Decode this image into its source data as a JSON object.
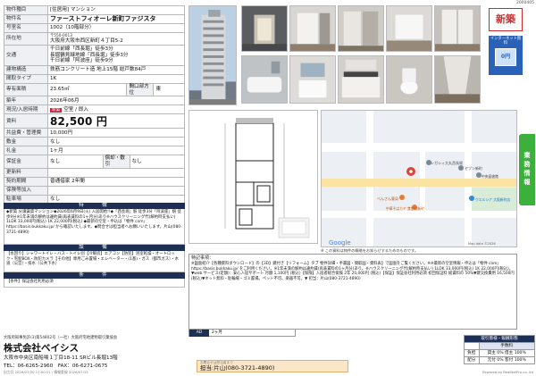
{
  "sheet_number": "2000405",
  "property": {
    "rows_top": [
      {
        "key": "物件種目",
        "value": "[住居用] マンション"
      },
      {
        "key": "物件名",
        "value": "ファーストフィオーレ新町ファジスタ"
      },
      {
        "key": "号室名",
        "value": "1002（10階部分）"
      }
    ],
    "location": {
      "key": "所在地",
      "zip": "〒550-0013",
      "address": "大阪府大阪市西区新町４丁目5-2"
    },
    "transport": {
      "key": "交通",
      "lines": [
        "千日前線「西長堀」徒歩3分",
        "長堀鶴見緑地線「西長堀」徒歩3分",
        "千日前線「阿波座」徒歩9分"
      ]
    },
    "structure": {
      "key": "建物構造",
      "value": "鉄筋コンクリート造 地上15階 総戸数84戸"
    },
    "layout": {
      "key": "間取タイプ",
      "value": "1K"
    },
    "area": {
      "key": "専有面積",
      "value": "23.65㎡",
      "key2": "間口部方位",
      "value2": "東"
    },
    "built": {
      "key": "築年",
      "value": "2026年06月"
    },
    "move_in": {
      "key": "現況/入居時期",
      "tag": "新築",
      "value": "空室 / 即入"
    },
    "rent": {
      "key": "賃料",
      "value": "82,500 円"
    },
    "common_fee": {
      "key": "共益費・管理費",
      "value": "10,000円"
    },
    "deposit": {
      "key": "敷金",
      "value": "なし"
    },
    "key_money": {
      "key": "礼金",
      "value": "1ヶ月"
    },
    "guarantee": {
      "key": "保証金",
      "value": "なし",
      "key2": "償却・敷引",
      "value2": "なし"
    },
    "renewal": {
      "key": "更新料",
      "value": ""
    },
    "contract_period": {
      "key": "契約期間",
      "value": "普通借家 2年間"
    },
    "insurance": {
      "key": "保険等加入",
      "value": ""
    },
    "parking": {
      "key": "駐車場",
      "value": "なし"
    }
  },
  "features": {
    "heading": "特　　徴",
    "text": "◆新築 分譲賃貸マンション◆2026年6月9日(火) 入居開始!!◆「西長堀」駅 徒歩3分「阿波座」駅 徒歩9分※1年未満の解約は違約賃(再表賃料の1ヶ月分)あり※ハウスクリーニング代(解約時支払い) 1LDK 33,000円(税込) 1K 22,000円(税込) ◆最新の空室・申込は「物件 com」https://basis.bukkaku.jp/ から確認いたします。◆問合せは担当者へお願いいたします。片山(080-3721-4890)"
  },
  "equipment": {
    "heading": "設　　備",
    "text": "【水回り】シャワートイレ・バス・トイレ別【冷暖房】エアコン【防犯】浴室乾燥・オートロック・宅配BOX・防犯カメラ【その他】専用ごみ置場・エレベーター・(1基)・ガス（都市ガス）・水道（公営）・排水（公共下水）"
  },
  "conditions": {
    "heading": "条　　件",
    "text": "【条件】保証会社利用必須"
  },
  "badges": {
    "new_label": "新築",
    "net_label": "インターネット無料",
    "net_screen": "0円"
  },
  "side_tab": "業務情報",
  "map": {
    "labels": [
      "レガシィ大丸西長堀",
      "セブン新町",
      "中央図書館",
      "べんさん薬局",
      "中華そばカヤ 食堂処新町",
      "ウエルシア 大阪新町店"
    ],
    "logo": "Google",
    "copyright": "Map data ©2026",
    "note": "※ この資料は物件の概略をお知らせするためのものです。"
  },
  "notes": {
    "title": "特記事項：",
    "text": "※図面紹介【各種資料ダウンロード】の【3D】鍵付き【リフォーム】タブ 物件詳細・手書図・間取図・資料表】で図面をご覧ください。※※最新の空室情報・申込は「物件 com」https://basis.bukkaku.jp/ をご利用ください。※1年未満の解約は違約賃(再表賃料の1ヶ月分)あり。※ハウスクリーニング代(解約時支払い) 1LDK 33,000円(税込) 1K 22,000円(税込)。▼web サービス(定額)：安心入居サポート 月額 1,100円 (税込)【保険】入居者総合保険 2年 20,000円 (税込)【保証】保証会社利用必須 初回保証料 総賃料の 50%▼鍵交換費用 16,500円 (税込)▼ネット無料・駐輪場・ゴミ置場。ペット不可、楽器不可。▼ 担当：片山(080-3721-4890)"
  },
  "strip": {
    "cells": [
      "AD",
      "2ヶ月"
    ]
  },
  "company": {
    "license": "大阪府知事免許(3)第54802号（一社）大阪府宅地建物取引業協会",
    "name": "株式会社ベイシス",
    "address": "大阪市中央区南船場１丁目18-11 SRビル長堀13階",
    "tel": "TEL：06-6265-2960　FAX：06-6271-0675"
  },
  "contact": {
    "note": "お問合せは担当者まで",
    "text": "担当:片山(080-3721-4890)"
  },
  "deal_table": {
    "title": "取引態様・報酬形態",
    "rows": [
      {
        "c1": "",
        "c2": "手数料"
      },
      {
        "c1": "負担",
        "c2": "貸主 0%  借主 100%"
      },
      {
        "c1": "配分",
        "c2": "元付 0%  客付 100%"
      }
    ]
  },
  "footer": "出力日 2026/07/30 17:00:21 / 情報登録 2026/07/15",
  "powered": "Powered by RealNetPro co. ltd"
}
